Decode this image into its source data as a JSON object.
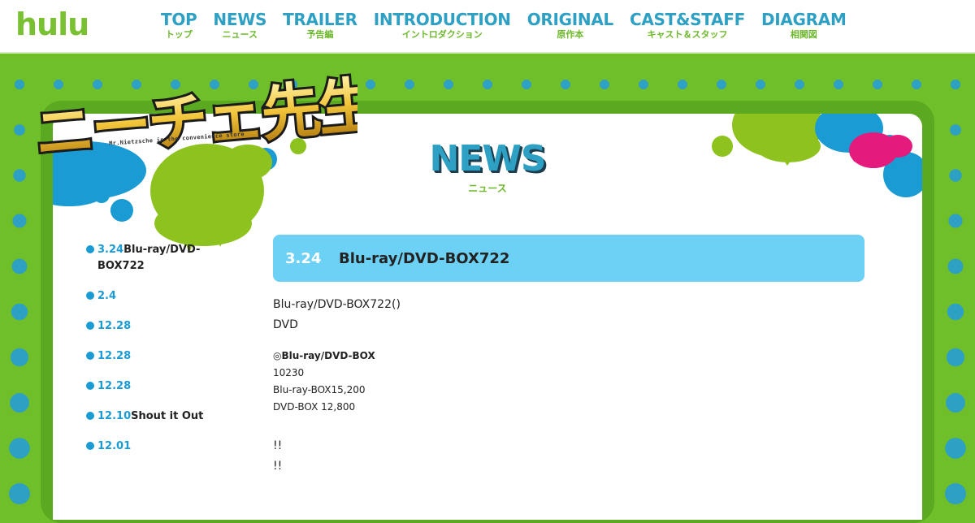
{
  "header": {
    "logo": "hulu",
    "nav": [
      {
        "en": "TOP",
        "ja": "トップ"
      },
      {
        "en": "NEWS",
        "ja": "ニュース"
      },
      {
        "en": "TRAILER",
        "ja": "予告編"
      },
      {
        "en": "INTRODUCTION",
        "ja": "イントロダクション"
      },
      {
        "en": "ORIGINAL",
        "ja": "原作本"
      },
      {
        "en": "CAST&STAFF",
        "ja": "キャスト＆スタッフ"
      },
      {
        "en": "DIAGRAM",
        "ja": "相関図"
      }
    ]
  },
  "show": {
    "title": "ニーチェ先生",
    "subtitle": "Mr.Nietzsche in the convenience store"
  },
  "section": {
    "title": "NEWS",
    "subtitle": "ニュース"
  },
  "news_list": [
    {
      "date": "3.24",
      "title": "Blu-ray/DVD-BOX722"
    },
    {
      "date": "2.4",
      "title": ""
    },
    {
      "date": "12.28",
      "title": ""
    },
    {
      "date": "12.28",
      "title": ""
    },
    {
      "date": "12.28",
      "title": ""
    },
    {
      "date": "12.10",
      "title": "Shout it Out"
    },
    {
      "date": "12.01",
      "title": ""
    }
  ],
  "article": {
    "date": "3.24",
    "title": "Blu-ray/DVD-BOX722",
    "intro_line1": "Blu-ray/DVD-BOX722()",
    "intro_line2": "DVD",
    "copyright": "◎Blu-ray/DVD-BOX",
    "detail1": "10230",
    "detail2": "Blu-ray-BOX15,200",
    "detail3": "DVD-BOX 12,800",
    "outro1": "!!",
    "outro2": "!!"
  },
  "colors": {
    "background_green": "#6ebf2a",
    "nav_blue": "#2ea0c4",
    "accent_blue": "#1a9bd4",
    "header_bar": "#6dd1f6",
    "splat_pink": "#e51a7d"
  }
}
